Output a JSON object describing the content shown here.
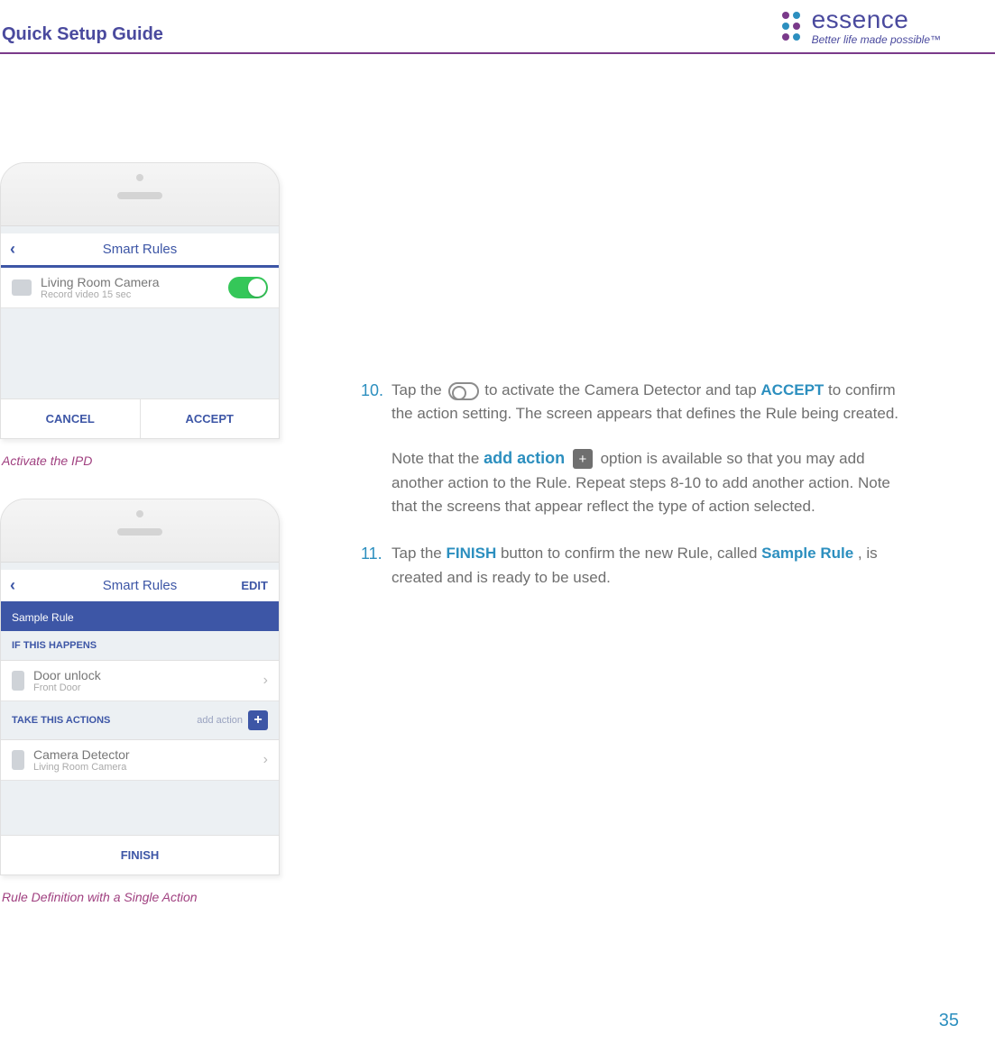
{
  "header": {
    "guide_title": "Quick Setup Guide",
    "brand_name": "essence",
    "brand_tag": "Better life made possible™"
  },
  "phone1": {
    "nav_title": "Smart Rules",
    "row_title": "Living Room Camera",
    "row_sub": "Record video 15 sec",
    "cancel": "CANCEL",
    "accept": "ACCEPT",
    "caption": "Activate the IPD"
  },
  "phone2": {
    "nav_title": "Smart Rules",
    "edit": "EDIT",
    "rule_name": "Sample Rule",
    "if_head": "IF THIS HAPPENS",
    "if_row_title": "Door unlock",
    "if_row_sub": "Front Door",
    "take_head": "TAKE THIS ACTIONS",
    "take_hint": "add action",
    "act_row_title": "Camera Detector",
    "act_row_sub": "Living Room Camera",
    "finish": "FINISH",
    "caption": "Rule Definition with a Single Action"
  },
  "steps": {
    "s10_num": "10.",
    "s10_a": "Tap the ",
    "s10_b": " to activate the Camera Detector and tap ",
    "s10_accept": "ACCEPT",
    "s10_c": " to confirm the action setting. The screen appears that defines the Rule being created.",
    "s10_note_a": "Note that the ",
    "s10_addaction": "add action",
    "s10_note_b": " option is available so that you may add another action to the Rule. Repeat steps 8-10 to add another action. Note that the screens that appear reflect the type of action selected.",
    "s11_num": "11.",
    "s11_a": "Tap the ",
    "s11_finish": "FINISH",
    "s11_b": " button to confirm the new Rule, called ",
    "s11_rule": "Sample Rule",
    "s11_c": ", is created and is ready to be used."
  },
  "page_number": "35"
}
